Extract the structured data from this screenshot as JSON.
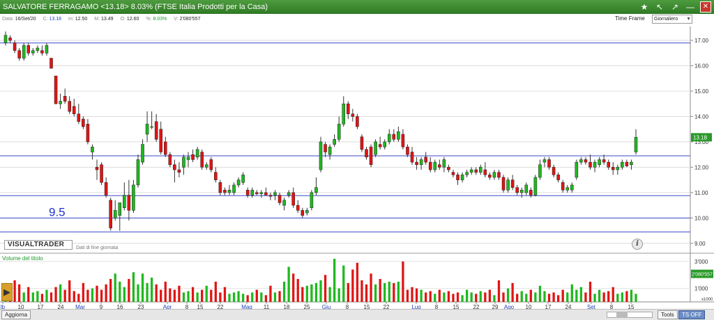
{
  "window": {
    "title": "SALVATORE FERRAGAMO <13.18> 8.03%  (FTSE Italia Prodotti per la Casa)",
    "buttons": [
      "★",
      "↖",
      "↗",
      "—",
      "✕"
    ]
  },
  "info": {
    "date_label": "Data:",
    "date": "16/Set/20",
    "close_label": "C:",
    "close": "13.18",
    "low_label": "m:",
    "low": "12.50",
    "high_label": "M:",
    "high": "13.49",
    "open_label": "O:",
    "open": "12.60",
    "pct_label": "%:",
    "pct": "8.03%",
    "vol_label": "V:",
    "vol": "2'080'557"
  },
  "timeframe": {
    "label": "Time Frame",
    "value": "Giornaliero"
  },
  "price_labels": [
    "17.00",
    "16.00",
    "15.00",
    "14.00",
    "13.00",
    "12.00",
    "11.00",
    "10.00",
    "9.00"
  ],
  "last_price_tag": "13.18",
  "annotation": "9.5",
  "logo": "VISUALTRADER",
  "logo_sub": "Dati di fine giornata",
  "volume_title": "Volume del titolo",
  "volume_labels": [
    "3'000",
    "1'000"
  ],
  "last_volume_tag": "2'080'557",
  "volume_unit": "x1000",
  "x_labels": [
    "lb",
    "10",
    "17",
    "24",
    "Mar",
    "9",
    "16",
    "23",
    "Apr",
    "8",
    "15",
    "22",
    "Mag",
    "11",
    "18",
    "25",
    "Giu",
    "8",
    "15",
    "22",
    "Lug",
    "8",
    "15",
    "22",
    "29",
    "Ago",
    "10",
    "17",
    "24",
    "Set",
    "8",
    "15"
  ],
  "bottom": {
    "aggiorna": "Aggiorna",
    "tools": "Tools",
    "ts_off": "TS OFF"
  },
  "colors": {
    "up": "#1fb81f",
    "down": "#e01414",
    "hline": "#3b48c7",
    "annotation": "#1f2fcc",
    "titlebar": "#3d8a30"
  },
  "chart_data": {
    "type": "candlestick",
    "y_range": [
      9.0,
      17.5
    ],
    "horizontal_lines": [
      16.9,
      12.45,
      10.88,
      10.0,
      9.45
    ],
    "candles": [
      {
        "o": 16.9,
        "h": 17.35,
        "l": 16.8,
        "c": 17.2
      },
      {
        "o": 17.1,
        "h": 17.2,
        "l": 16.9,
        "c": 17.0
      },
      {
        "o": 16.9,
        "h": 17.0,
        "l": 16.5,
        "c": 16.6
      },
      {
        "o": 16.6,
        "h": 16.7,
        "l": 16.2,
        "c": 16.3
      },
      {
        "o": 16.3,
        "h": 16.9,
        "l": 16.2,
        "c": 16.8
      },
      {
        "o": 16.8,
        "h": 16.9,
        "l": 16.4,
        "c": 16.5
      },
      {
        "o": 16.5,
        "h": 16.7,
        "l": 16.4,
        "c": 16.6
      },
      {
        "o": 16.6,
        "h": 16.8,
        "l": 16.5,
        "c": 16.7
      },
      {
        "o": 16.6,
        "h": 16.8,
        "l": 16.4,
        "c": 16.5
      },
      {
        "o": 16.5,
        "h": 16.9,
        "l": 16.4,
        "c": 16.8
      },
      {
        "o": 16.3,
        "h": 16.3,
        "l": 15.9,
        "c": 15.9
      },
      {
        "o": 15.6,
        "h": 15.6,
        "l": 14.5,
        "c": 14.5
      },
      {
        "o": 14.5,
        "h": 14.9,
        "l": 14.3,
        "c": 14.6
      },
      {
        "o": 14.8,
        "h": 15.1,
        "l": 14.5,
        "c": 14.6
      },
      {
        "o": 14.6,
        "h": 14.8,
        "l": 14.1,
        "c": 14.2
      },
      {
        "o": 14.4,
        "h": 14.7,
        "l": 14.0,
        "c": 14.1
      },
      {
        "o": 14.1,
        "h": 14.5,
        "l": 13.7,
        "c": 13.8
      },
      {
        "o": 13.9,
        "h": 14.0,
        "l": 13.5,
        "c": 13.6
      },
      {
        "o": 13.7,
        "h": 13.9,
        "l": 12.9,
        "c": 13.0
      },
      {
        "o": 12.6,
        "h": 12.9,
        "l": 12.3,
        "c": 12.8
      },
      {
        "o": 12.0,
        "h": 12.3,
        "l": 11.5,
        "c": 11.9
      },
      {
        "o": 12.1,
        "h": 12.2,
        "l": 11.3,
        "c": 11.4
      },
      {
        "o": 11.4,
        "h": 11.6,
        "l": 10.8,
        "c": 10.9
      },
      {
        "o": 10.7,
        "h": 10.8,
        "l": 9.5,
        "c": 9.6
      },
      {
        "o": 10.0,
        "h": 10.7,
        "l": 9.9,
        "c": 10.3
      },
      {
        "o": 10.1,
        "h": 10.6,
        "l": 9.5,
        "c": 10.6
      },
      {
        "o": 10.4,
        "h": 11.4,
        "l": 10.3,
        "c": 10.9
      },
      {
        "o": 10.9,
        "h": 11.5,
        "l": 9.9,
        "c": 10.3
      },
      {
        "o": 10.3,
        "h": 11.5,
        "l": 10.2,
        "c": 11.3
      },
      {
        "o": 11.3,
        "h": 12.5,
        "l": 11.2,
        "c": 12.3
      },
      {
        "o": 12.2,
        "h": 13.1,
        "l": 12.1,
        "c": 12.9
      },
      {
        "o": 13.3,
        "h": 14.2,
        "l": 13.0,
        "c": 13.7
      },
      {
        "o": 13.6,
        "h": 14.2,
        "l": 13.5,
        "c": 13.6
      },
      {
        "o": 13.8,
        "h": 14.1,
        "l": 13.0,
        "c": 13.1
      },
      {
        "o": 13.5,
        "h": 13.8,
        "l": 12.5,
        "c": 12.6
      },
      {
        "o": 13.0,
        "h": 13.2,
        "l": 12.4,
        "c": 12.5
      },
      {
        "o": 12.5,
        "h": 12.6,
        "l": 12.0,
        "c": 12.1
      },
      {
        "o": 12.1,
        "h": 12.3,
        "l": 11.4,
        "c": 11.9
      },
      {
        "o": 11.9,
        "h": 12.2,
        "l": 11.6,
        "c": 11.8
      },
      {
        "o": 12.0,
        "h": 12.5,
        "l": 11.7,
        "c": 12.4
      },
      {
        "o": 12.3,
        "h": 12.6,
        "l": 12.0,
        "c": 12.4
      },
      {
        "o": 12.5,
        "h": 12.7,
        "l": 12.2,
        "c": 12.3
      },
      {
        "o": 12.4,
        "h": 12.8,
        "l": 12.3,
        "c": 12.7
      },
      {
        "o": 12.6,
        "h": 12.7,
        "l": 11.9,
        "c": 12.0
      },
      {
        "o": 12.0,
        "h": 12.2,
        "l": 11.9,
        "c": 12.1
      },
      {
        "o": 12.3,
        "h": 12.4,
        "l": 11.8,
        "c": 11.9
      },
      {
        "o": 11.8,
        "h": 12.0,
        "l": 11.4,
        "c": 11.5
      },
      {
        "o": 11.4,
        "h": 11.5,
        "l": 10.9,
        "c": 11.0
      },
      {
        "o": 11.1,
        "h": 11.2,
        "l": 10.9,
        "c": 11.0
      },
      {
        "o": 11.0,
        "h": 11.3,
        "l": 10.9,
        "c": 11.1
      },
      {
        "o": 11.0,
        "h": 11.4,
        "l": 10.9,
        "c": 11.3
      },
      {
        "o": 11.3,
        "h": 11.6,
        "l": 11.2,
        "c": 11.5
      },
      {
        "o": 11.4,
        "h": 11.8,
        "l": 11.3,
        "c": 11.7
      },
      {
        "o": 11.1,
        "h": 11.2,
        "l": 10.8,
        "c": 10.9
      },
      {
        "o": 10.9,
        "h": 11.2,
        "l": 10.8,
        "c": 11.1
      },
      {
        "o": 11.0,
        "h": 11.1,
        "l": 10.9,
        "c": 10.95
      },
      {
        "o": 10.95,
        "h": 11.1,
        "l": 10.8,
        "c": 11.0
      },
      {
        "o": 11.0,
        "h": 11.2,
        "l": 10.9,
        "c": 10.9
      },
      {
        "o": 10.9,
        "h": 11.0,
        "l": 10.7,
        "c": 10.85
      },
      {
        "o": 10.9,
        "h": 11.1,
        "l": 10.7,
        "c": 11.0
      },
      {
        "o": 10.9,
        "h": 11.0,
        "l": 10.5,
        "c": 10.6
      },
      {
        "o": 10.5,
        "h": 10.8,
        "l": 10.3,
        "c": 10.7
      },
      {
        "o": 10.9,
        "h": 11.1,
        "l": 10.8,
        "c": 11.0
      },
      {
        "o": 11.0,
        "h": 11.2,
        "l": 10.4,
        "c": 10.5
      },
      {
        "o": 10.5,
        "h": 10.7,
        "l": 10.2,
        "c": 10.3
      },
      {
        "o": 10.3,
        "h": 10.4,
        "l": 10.0,
        "c": 10.1
      },
      {
        "o": 10.2,
        "h": 10.4,
        "l": 10.1,
        "c": 10.3
      },
      {
        "o": 10.4,
        "h": 11.1,
        "l": 10.3,
        "c": 11.0
      },
      {
        "o": 11.0,
        "h": 11.6,
        "l": 10.9,
        "c": 11.2
      },
      {
        "o": 11.9,
        "h": 13.2,
        "l": 11.8,
        "c": 13.0
      },
      {
        "o": 12.9,
        "h": 13.0,
        "l": 12.4,
        "c": 12.6
      },
      {
        "o": 12.5,
        "h": 12.9,
        "l": 12.3,
        "c": 12.8
      },
      {
        "o": 12.9,
        "h": 13.3,
        "l": 12.8,
        "c": 13.1
      },
      {
        "o": 13.1,
        "h": 14.0,
        "l": 13.0,
        "c": 13.7
      },
      {
        "o": 13.7,
        "h": 14.8,
        "l": 13.6,
        "c": 14.5
      },
      {
        "o": 14.5,
        "h": 14.6,
        "l": 13.9,
        "c": 14.1
      },
      {
        "o": 14.1,
        "h": 14.3,
        "l": 13.8,
        "c": 14.0
      },
      {
        "o": 14.0,
        "h": 14.1,
        "l": 13.5,
        "c": 13.6
      },
      {
        "o": 13.2,
        "h": 13.3,
        "l": 12.6,
        "c": 12.7
      },
      {
        "o": 12.7,
        "h": 12.8,
        "l": 12.3,
        "c": 12.4
      },
      {
        "o": 12.8,
        "h": 12.9,
        "l": 12.0,
        "c": 12.1
      },
      {
        "o": 12.5,
        "h": 13.1,
        "l": 12.4,
        "c": 13.0
      },
      {
        "o": 12.9,
        "h": 13.2,
        "l": 12.7,
        "c": 12.8
      },
      {
        "o": 12.8,
        "h": 13.1,
        "l": 12.7,
        "c": 13.0
      },
      {
        "o": 13.0,
        "h": 13.5,
        "l": 12.9,
        "c": 13.3
      },
      {
        "o": 13.3,
        "h": 13.5,
        "l": 13.0,
        "c": 13.1
      },
      {
        "o": 13.1,
        "h": 13.6,
        "l": 13.0,
        "c": 13.4
      },
      {
        "o": 13.3,
        "h": 13.5,
        "l": 12.7,
        "c": 12.8
      },
      {
        "o": 12.8,
        "h": 12.9,
        "l": 12.4,
        "c": 12.5
      },
      {
        "o": 12.6,
        "h": 12.8,
        "l": 12.1,
        "c": 12.2
      },
      {
        "o": 12.2,
        "h": 12.4,
        "l": 11.9,
        "c": 12.1
      },
      {
        "o": 12.1,
        "h": 12.4,
        "l": 11.9,
        "c": 12.3
      },
      {
        "o": 12.4,
        "h": 12.6,
        "l": 12.1,
        "c": 12.2
      },
      {
        "o": 12.2,
        "h": 12.4,
        "l": 11.8,
        "c": 11.9
      },
      {
        "o": 11.9,
        "h": 12.3,
        "l": 11.8,
        "c": 12.2
      },
      {
        "o": 12.1,
        "h": 12.3,
        "l": 11.9,
        "c": 12.0
      },
      {
        "o": 12.0,
        "h": 12.4,
        "l": 11.8,
        "c": 12.3
      },
      {
        "o": 12.0,
        "h": 12.1,
        "l": 11.8,
        "c": 11.9
      },
      {
        "o": 11.8,
        "h": 11.9,
        "l": 11.6,
        "c": 11.7
      },
      {
        "o": 11.7,
        "h": 11.8,
        "l": 11.3,
        "c": 11.5
      },
      {
        "o": 11.5,
        "h": 11.8,
        "l": 11.4,
        "c": 11.7
      },
      {
        "o": 11.7,
        "h": 11.9,
        "l": 11.6,
        "c": 11.8
      },
      {
        "o": 11.8,
        "h": 12.0,
        "l": 11.7,
        "c": 11.9
      },
      {
        "o": 11.9,
        "h": 12.0,
        "l": 11.7,
        "c": 11.8
      },
      {
        "o": 11.8,
        "h": 12.1,
        "l": 11.7,
        "c": 12.0
      },
      {
        "o": 11.9,
        "h": 12.2,
        "l": 11.6,
        "c": 11.7
      },
      {
        "o": 11.7,
        "h": 11.8,
        "l": 11.5,
        "c": 11.6
      },
      {
        "o": 11.6,
        "h": 11.9,
        "l": 11.5,
        "c": 11.8
      },
      {
        "o": 11.8,
        "h": 11.9,
        "l": 11.5,
        "c": 11.6
      },
      {
        "o": 11.6,
        "h": 11.7,
        "l": 11.0,
        "c": 11.1
      },
      {
        "o": 11.1,
        "h": 11.6,
        "l": 11.0,
        "c": 11.5
      },
      {
        "o": 11.5,
        "h": 11.7,
        "l": 11.1,
        "c": 11.2
      },
      {
        "o": 11.2,
        "h": 11.3,
        "l": 10.9,
        "c": 11.0
      },
      {
        "o": 11.0,
        "h": 11.2,
        "l": 10.8,
        "c": 11.1
      },
      {
        "o": 11.0,
        "h": 11.4,
        "l": 10.9,
        "c": 11.3
      },
      {
        "o": 11.1,
        "h": 11.2,
        "l": 10.8,
        "c": 10.9
      },
      {
        "o": 10.9,
        "h": 11.7,
        "l": 10.85,
        "c": 11.6
      },
      {
        "o": 11.6,
        "h": 12.3,
        "l": 11.5,
        "c": 12.1
      },
      {
        "o": 12.2,
        "h": 12.4,
        "l": 12.0,
        "c": 12.3
      },
      {
        "o": 12.3,
        "h": 12.4,
        "l": 11.9,
        "c": 12.0
      },
      {
        "o": 12.0,
        "h": 12.1,
        "l": 11.6,
        "c": 11.7
      },
      {
        "o": 11.7,
        "h": 11.8,
        "l": 11.4,
        "c": 11.5
      },
      {
        "o": 11.4,
        "h": 11.5,
        "l": 11.0,
        "c": 11.1
      },
      {
        "o": 11.1,
        "h": 11.3,
        "l": 11.0,
        "c": 11.2
      },
      {
        "o": 11.1,
        "h": 11.4,
        "l": 11.0,
        "c": 11.3
      },
      {
        "o": 11.6,
        "h": 12.3,
        "l": 11.5,
        "c": 12.2
      },
      {
        "o": 12.2,
        "h": 12.4,
        "l": 12.1,
        "c": 12.3
      },
      {
        "o": 12.3,
        "h": 12.4,
        "l": 12.1,
        "c": 12.2
      },
      {
        "o": 12.2,
        "h": 12.5,
        "l": 11.9,
        "c": 12.0
      },
      {
        "o": 12.0,
        "h": 12.3,
        "l": 11.8,
        "c": 12.2
      },
      {
        "o": 12.1,
        "h": 12.4,
        "l": 12.0,
        "c": 12.3
      },
      {
        "o": 12.3,
        "h": 12.5,
        "l": 12.1,
        "c": 12.2
      },
      {
        "o": 12.2,
        "h": 12.3,
        "l": 11.9,
        "c": 12.0
      },
      {
        "o": 12.0,
        "h": 12.2,
        "l": 11.7,
        "c": 11.9
      },
      {
        "o": 11.9,
        "h": 12.1,
        "l": 11.7,
        "c": 12.0
      },
      {
        "o": 12.0,
        "h": 12.3,
        "l": 11.9,
        "c": 12.2
      },
      {
        "o": 12.2,
        "h": 12.3,
        "l": 12.0,
        "c": 12.05
      },
      {
        "o": 12.1,
        "h": 12.3,
        "l": 11.9,
        "c": 12.2
      },
      {
        "o": 12.6,
        "h": 13.5,
        "l": 12.5,
        "c": 13.18
      }
    ],
    "volumes": [
      1400,
      900,
      1600,
      1300,
      700,
      1100,
      700,
      800,
      600,
      900,
      700,
      1100,
      1300,
      900,
      1600,
      800,
      600,
      1400,
      900,
      1000,
      1200,
      900,
      1300,
      1700,
      2100,
      1500,
      1100,
      1700,
      2200,
      1300,
      2100,
      1400,
      1800,
      1300,
      900,
      1500,
      1000,
      900,
      1200,
      700,
      800,
      1100,
      700,
      900,
      1200,
      900,
      1500,
      700,
      1100,
      600,
      700,
      800,
      600,
      500,
      700,
      900,
      700,
      500,
      1200,
      700,
      800,
      1500,
      2600,
      2100,
      1700,
      1100,
      1200,
      1300,
      1400,
      1600,
      2000,
      1100,
      3200,
      1000,
      2700,
      1400,
      2400,
      2900,
      1600,
      1300,
      2100,
      1300,
      1700,
      1400,
      1500,
      1400,
      1500,
      3000,
      900,
      1100,
      1000,
      900,
      700,
      800,
      600,
      900,
      700,
      800,
      600,
      700,
      500,
      900,
      700,
      600,
      800,
      700,
      900,
      500,
      1600,
      700,
      1000,
      1400,
      600,
      800,
      600,
      900,
      700,
      1200,
      800,
      600,
      700,
      500,
      900,
      700,
      1300,
      900,
      1100,
      700,
      1500,
      600,
      900,
      700,
      800,
      1100,
      600,
      700,
      800,
      900,
      600,
      700,
      2080
    ]
  }
}
